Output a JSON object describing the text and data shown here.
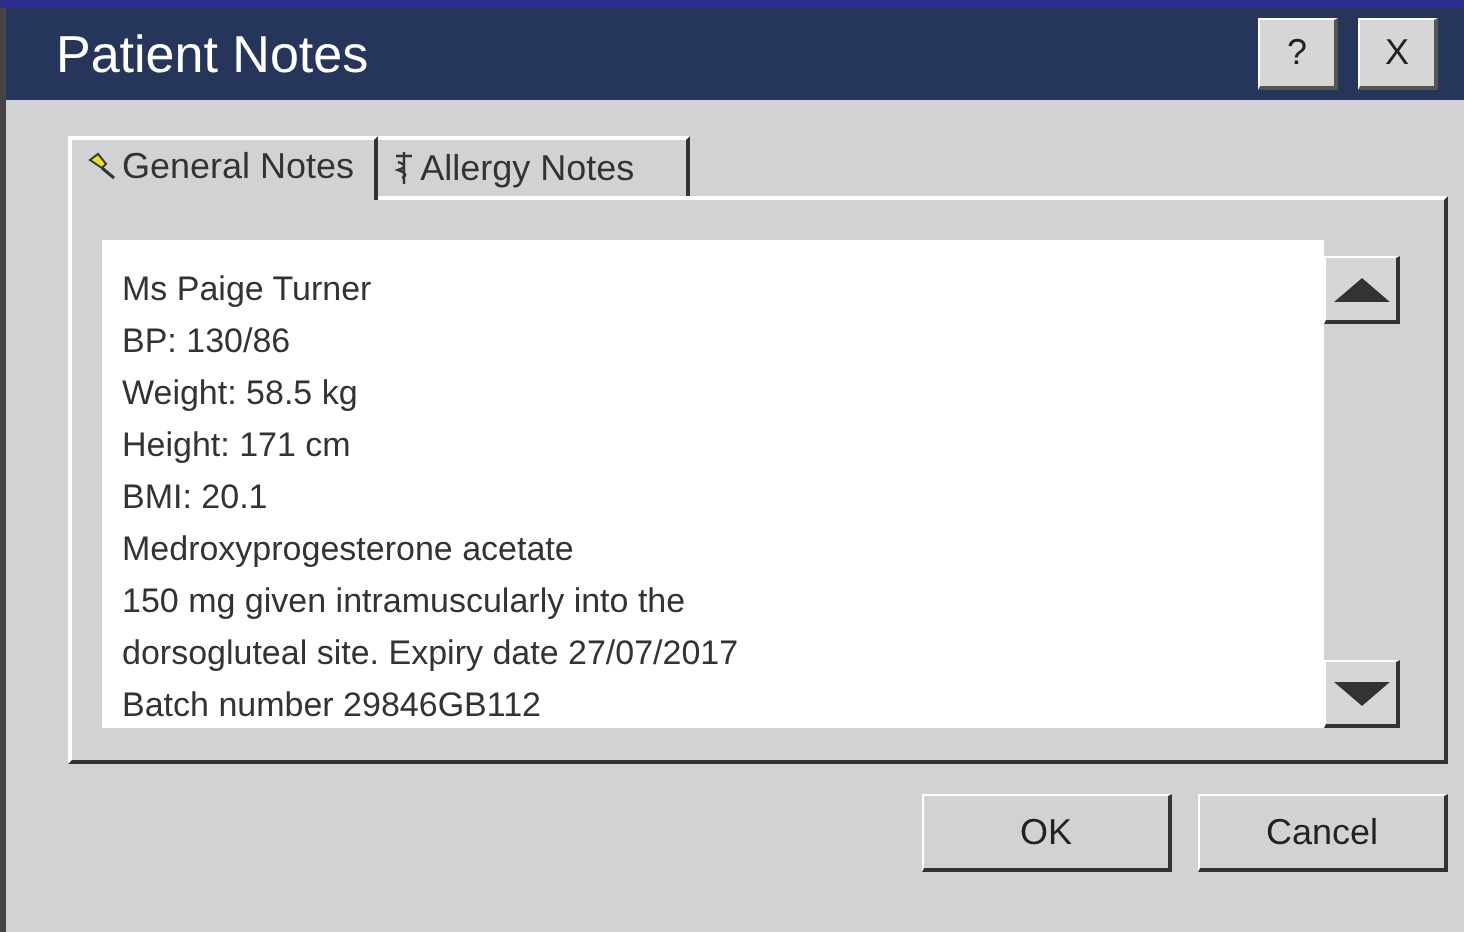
{
  "window": {
    "title": "Patient Notes",
    "title_buttons": [
      "?",
      "X"
    ]
  },
  "tabs": [
    {
      "label": "General Notes",
      "selected": true
    },
    {
      "label": "Allergy Notes",
      "selected": false
    }
  ],
  "notes": {
    "lines": [
      "Ms Paige Turner",
      "BP: 130/86",
      "Weight: 58.5 kg",
      "Height: 171 cm",
      "BMI: 20.1",
      "Medroxyprogesterone acetate",
      "150 mg given intramuscularly into the",
      "dorsogluteal site. Expiry date 27/07/2017",
      "Batch number 29846GB112"
    ]
  },
  "buttons": [
    "OK",
    "Cancel"
  ]
}
